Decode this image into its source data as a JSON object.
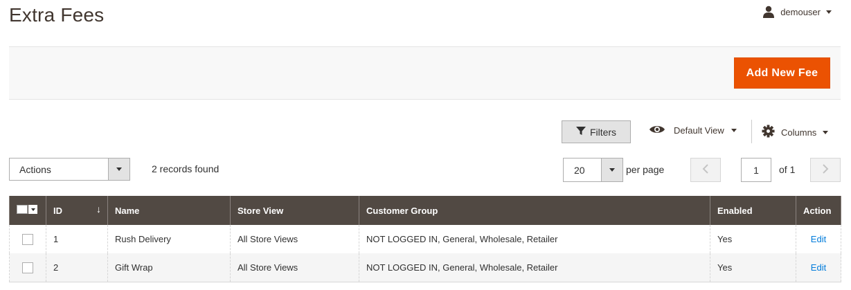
{
  "header": {
    "title": "Extra Fees",
    "user": {
      "name": "demouser",
      "icon": "user-icon"
    }
  },
  "actionBar": {
    "add_label": "Add New Fee",
    "accent": "#eb5202"
  },
  "toolbar": {
    "filters_label": "Filters",
    "view_label": "Default View",
    "columns_label": "Columns"
  },
  "massActions": {
    "selected": "Actions",
    "records_found": "2 records found"
  },
  "pagination": {
    "per_page_value": "20",
    "per_page_label": "per page",
    "current_page": "1",
    "of_label": "of 1"
  },
  "grid": {
    "header_bg": "#514943",
    "columns": {
      "id": "ID",
      "name": "Name",
      "store_view": "Store View",
      "customer_group": "Customer Group",
      "enabled": "Enabled",
      "action": "Action"
    },
    "rows": [
      {
        "id": "1",
        "name": "Rush Delivery",
        "store_view": "All Store Views",
        "customer_group": "NOT LOGGED IN, General, Wholesale, Retailer",
        "enabled": "Yes",
        "action": "Edit"
      },
      {
        "id": "2",
        "name": "Gift Wrap",
        "store_view": "All Store Views",
        "customer_group": "NOT LOGGED IN, General, Wholesale, Retailer",
        "enabled": "Yes",
        "action": "Edit"
      }
    ]
  }
}
